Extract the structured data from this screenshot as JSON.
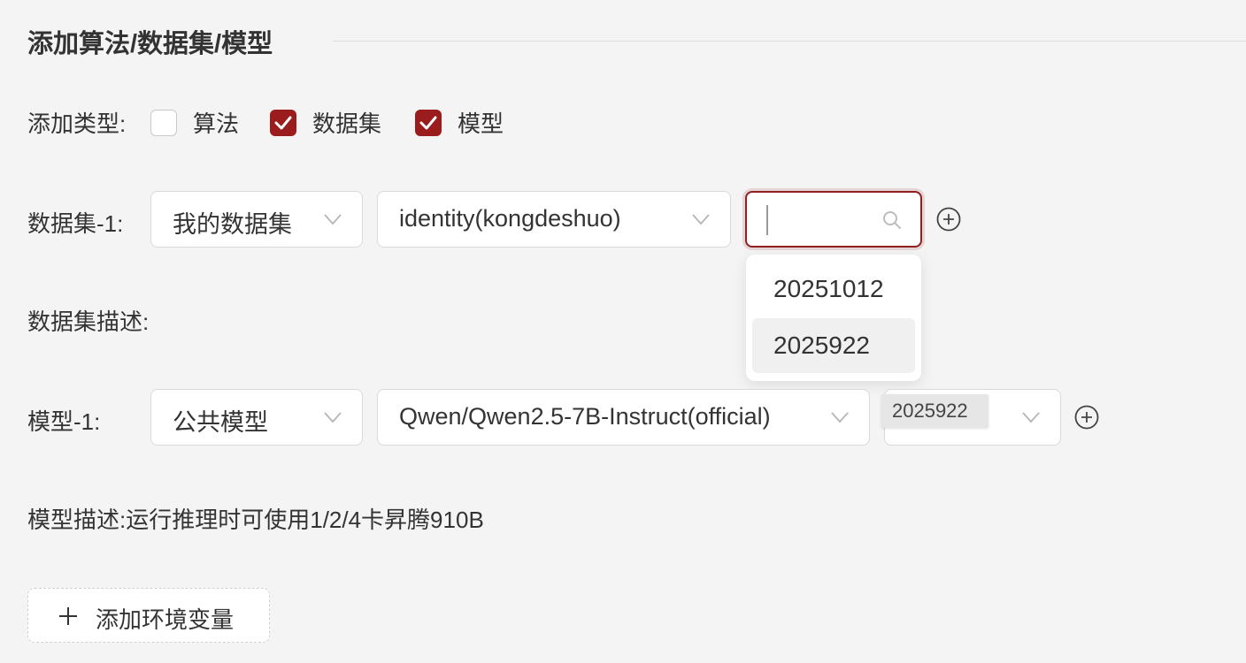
{
  "section": {
    "title": "添加算法/数据集/模型"
  },
  "add_type": {
    "label": "添加类型:",
    "options": [
      {
        "label": "算法",
        "checked": false
      },
      {
        "label": "数据集",
        "checked": true
      },
      {
        "label": "模型",
        "checked": true
      }
    ]
  },
  "dataset": {
    "label": "数据集-1:",
    "source": "我的数据集",
    "name": "identity(kongdeshuo)",
    "version_search": "",
    "version_options": [
      "20251012",
      "2025922"
    ],
    "description_label": "数据集描述:"
  },
  "model": {
    "label": "模型-1:",
    "source": "公共模型",
    "name": "Qwen/Qwen2.5-7B-Instruct(official)",
    "version_tooltip": "2025922",
    "description_label": "模型描述:",
    "description": "运行推理时可使用1/2/4卡昇腾910B"
  },
  "add_env_button": "添加环境变量",
  "colors": {
    "accent": "#9b1c1c",
    "background": "#f4f4f4"
  },
  "icons": [
    "check-icon",
    "chevron-down-icon",
    "search-icon",
    "plus-circle-icon",
    "plus-icon"
  ]
}
